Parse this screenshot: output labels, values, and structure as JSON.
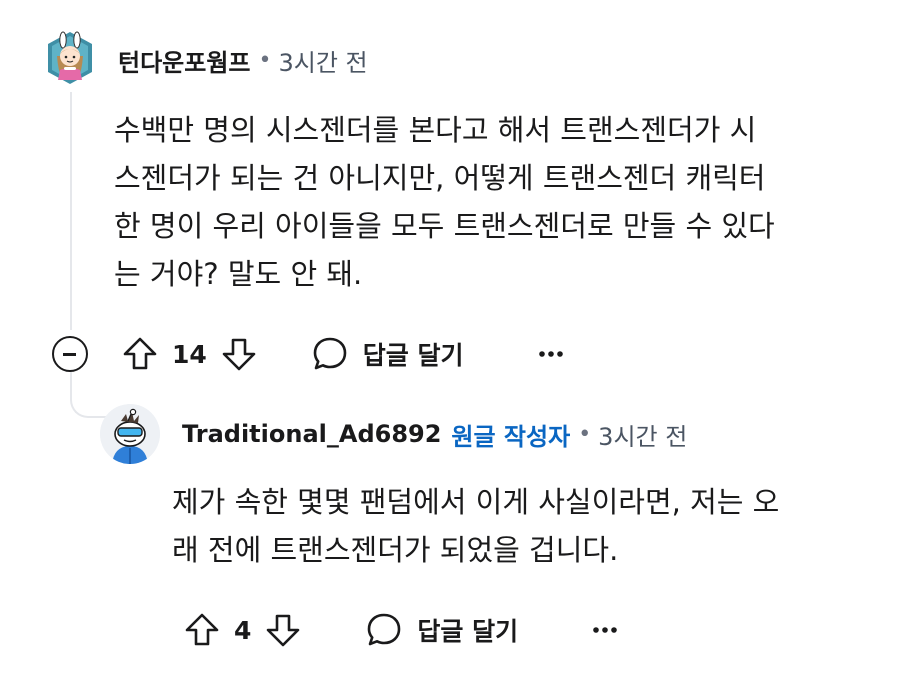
{
  "comments": [
    {
      "username": "턴다운포웜프",
      "separator": "•",
      "time": "3시간 전",
      "body_lines": [
        "수백만 명의 시스젠더를 본다고 해서 트랜스젠더가 시",
        "스젠더가 되는 건 아니지만, 어떻게 트랜스젠더 캐릭터",
        "한 명이 우리 아이들을 모두 트랜스젠더로 만들 수 있다",
        "는 거야? 말도 안 돼."
      ],
      "votes": "14",
      "reply_label": "답글 달기",
      "icons": [
        "upvote-icon",
        "downvote-icon",
        "reply-bubble-icon",
        "more-options-icon",
        "collapse-minus-icon"
      ]
    },
    {
      "username": "Traditional_Ad6892",
      "op_badge": "원글 작성자",
      "separator": "•",
      "time": "3시간 전",
      "body_lines": [
        "제가 속한 몇몇 팬덤에서 이게 사실이라면, 저는 오",
        "래 전에 트랜스젠더가 되었을 겁니다."
      ],
      "votes": "4",
      "reply_label": "답글 달기",
      "icons": [
        "upvote-icon",
        "downvote-icon",
        "reply-bubble-icon",
        "more-options-icon"
      ]
    }
  ],
  "colors": {
    "text": "#1a1a1b",
    "muted": "#4b5563",
    "op_badge": "#0a66c2",
    "thread_line": "#e5e7eb"
  }
}
